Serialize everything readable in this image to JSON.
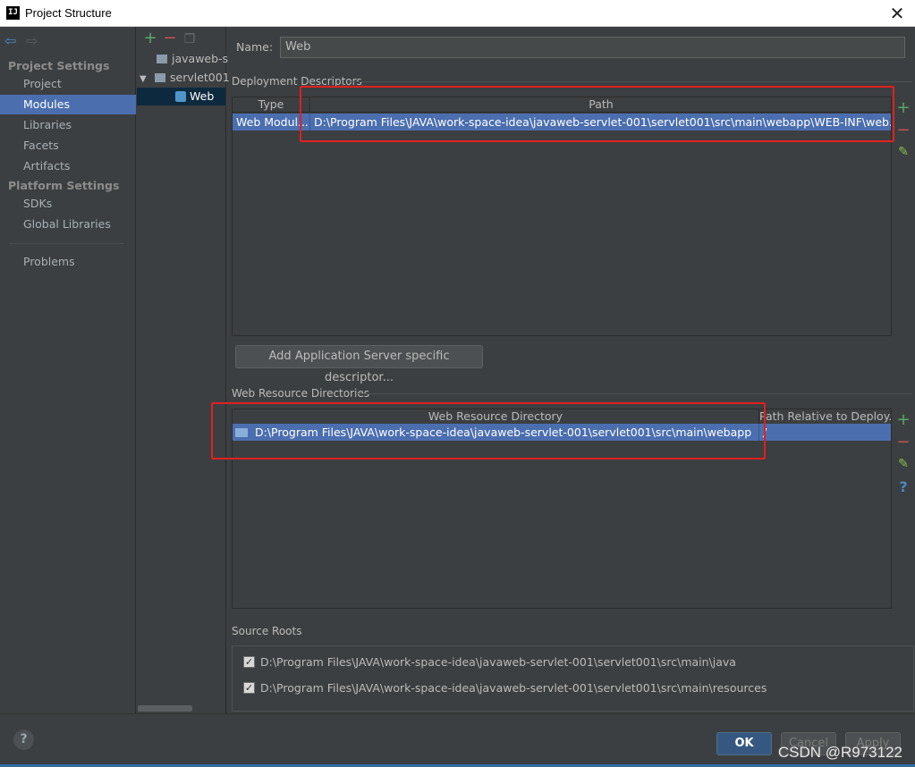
{
  "window": {
    "title": "Project Structure",
    "app_icon": "IJ"
  },
  "nav": {
    "back_icon": "back-arrow-icon",
    "forward_icon": "forward-arrow-icon",
    "project_settings_header": "Project Settings",
    "platform_settings_header": "Platform Settings",
    "items": [
      {
        "label": "Project"
      },
      {
        "label": "Modules"
      },
      {
        "label": "Libraries"
      },
      {
        "label": "Facets"
      },
      {
        "label": "Artifacts"
      },
      {
        "label": "SDKs"
      },
      {
        "label": "Global Libraries"
      },
      {
        "label": "Problems"
      }
    ],
    "selected": "Modules"
  },
  "tree": {
    "items": [
      {
        "label": "javaweb-s"
      },
      {
        "label": "servlet001"
      },
      {
        "label": "Web"
      }
    ]
  },
  "facet": {
    "name_label": "Name:",
    "name_value": "Web"
  },
  "deployment": {
    "title": "Deployment Descriptors",
    "col_type": "Type",
    "col_path": "Path",
    "row_type": "Web Modul...",
    "row_path": "D:\\Program Files\\JAVA\\work-space-idea\\javaweb-servlet-001\\servlet001\\src\\main\\webapp\\WEB-INF\\web.xml",
    "add_server_button": "Add Application Server specific descriptor..."
  },
  "web_resources": {
    "title": "Web Resource Directories",
    "col_dir": "Web Resource Directory",
    "col_rel": "Path Relative to Deploy...",
    "row_dir": "D:\\Program Files\\JAVA\\work-space-idea\\javaweb-servlet-001\\servlet001\\src\\main\\webapp",
    "row_rel": "/"
  },
  "source_roots": {
    "title": "Source Roots",
    "items": [
      {
        "path": "D:\\Program Files\\JAVA\\work-space-idea\\javaweb-servlet-001\\servlet001\\src\\main\\java",
        "checked": true
      },
      {
        "path": "D:\\Program Files\\JAVA\\work-space-idea\\javaweb-servlet-001\\servlet001\\src\\main\\resources",
        "checked": true
      }
    ]
  },
  "footer": {
    "ok_label": "OK",
    "cancel_label": "Cancel",
    "apply_label": "Apply",
    "watermark": "CSDN @R973122"
  },
  "colors": {
    "background": "#3c3f41",
    "selection": "#4b6eaf",
    "annotation_red": "#e02020",
    "add_green": "#59a869",
    "remove_red": "#c75450"
  }
}
